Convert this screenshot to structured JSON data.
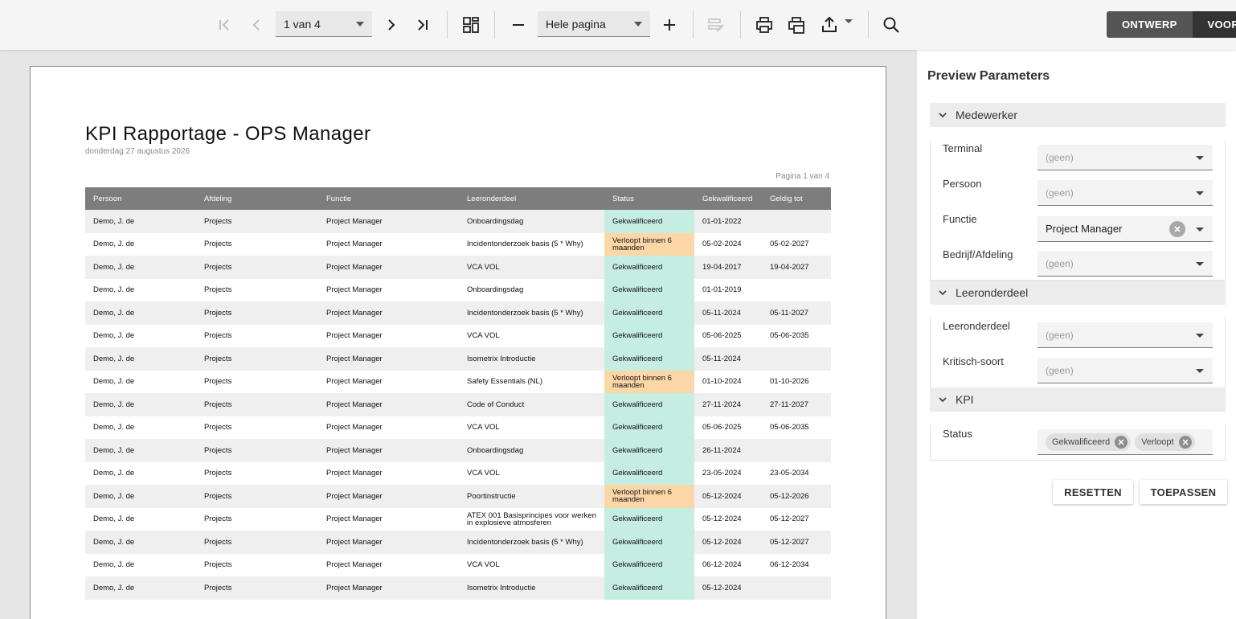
{
  "toolbar": {
    "page_select_value": "1 van 4",
    "zoom_select_value": "Hele pagina",
    "mode_design": "ONTWERP",
    "mode_preview": "VOORBE"
  },
  "report": {
    "title": "KPI Rapportage - OPS Manager",
    "date": "donderdag 27 augustus 2026",
    "page_indicator": "Pagina 1 van 4",
    "columns": [
      "Persoon",
      "Afdeling",
      "Functie",
      "Leeronderdeel",
      "Status",
      "Gekwalificeerd",
      "Geldig tot"
    ],
    "status_colors": {
      "Gekwalificeerd": "#c6ede2",
      "Verloopt binnen 6 maanden": "#fbd7a8"
    },
    "rows": [
      [
        "Demo, J. de",
        "Projects",
        "Project Manager",
        "Onboardingsdag",
        "Gekwalificeerd",
        "01-01-2022",
        ""
      ],
      [
        "Demo, J. de",
        "Projects",
        "Project Manager",
        "Incidentonderzoek basis (5 * Why)",
        "Verloopt binnen 6 maanden",
        "05-02-2024",
        "05-02-2027"
      ],
      [
        "Demo, J. de",
        "Projects",
        "Project Manager",
        "VCA VOL",
        "Gekwalificeerd",
        "19-04-2017",
        "19-04-2027"
      ],
      [
        "Demo, J. de",
        "Projects",
        "Project Manager",
        "Onboardingsdag",
        "Gekwalificeerd",
        "01-01-2019",
        ""
      ],
      [
        "Demo, J. de",
        "Projects",
        "Project Manager",
        "Incidentonderzoek basis (5 * Why)",
        "Gekwalificeerd",
        "05-11-2024",
        "05-11-2027"
      ],
      [
        "Demo, J. de",
        "Projects",
        "Project Manager",
        "VCA VOL",
        "Gekwalificeerd",
        "05-06-2025",
        "05-06-2035"
      ],
      [
        "Demo, J. de",
        "Projects",
        "Project Manager",
        "Isometrix Introductie",
        "Gekwalificeerd",
        "05-11-2024",
        ""
      ],
      [
        "Demo, J. de",
        "Projects",
        "Project Manager",
        "Safety Essentials (NL)",
        "Verloopt binnen 6 maanden",
        "01-10-2024",
        "01-10-2026"
      ],
      [
        "Demo, J. de",
        "Projects",
        "Project Manager",
        "Code of Conduct",
        "Gekwalificeerd",
        "27-11-2024",
        "27-11-2027"
      ],
      [
        "Demo, J. de",
        "Projects",
        "Project Manager",
        "VCA VOL",
        "Gekwalificeerd",
        "05-06-2025",
        "05-06-2035"
      ],
      [
        "Demo, J. de",
        "Projects",
        "Project Manager",
        "Onboardingsdag",
        "Gekwalificeerd",
        "26-11-2024",
        ""
      ],
      [
        "Demo, J. de",
        "Projects",
        "Project Manager",
        "VCA VOL",
        "Gekwalificeerd",
        "23-05-2024",
        "23-05-2034"
      ],
      [
        "Demo, J. de",
        "Projects",
        "Project Manager",
        "Poortinstructie",
        "Verloopt binnen 6 maanden",
        "05-12-2024",
        "05-12-2026"
      ],
      [
        "Demo, J. de",
        "Projects",
        "Project Manager",
        "ATEX 001 Basisprincipes voor werken in explosieve atmosferen",
        "Gekwalificeerd",
        "05-12-2024",
        "05-12-2027"
      ],
      [
        "Demo, J. de",
        "Projects",
        "Project Manager",
        "Incidentonderzoek basis (5 * Why)",
        "Gekwalificeerd",
        "05-12-2024",
        "05-12-2027"
      ],
      [
        "Demo, J. de",
        "Projects",
        "Project Manager",
        "VCA VOL",
        "Gekwalificeerd",
        "06-12-2024",
        "06-12-2034"
      ],
      [
        "Demo, J. de",
        "Projects",
        "Project Manager",
        "Isometrix Introductie",
        "Gekwalificeerd",
        "05-12-2024",
        ""
      ]
    ]
  },
  "panel": {
    "title": "Preview Parameters",
    "groups": {
      "medewerker": "Medewerker",
      "leeronderdeel": "Leeronderdeel",
      "kpi": "KPI"
    },
    "params": {
      "terminal": {
        "label": "Terminal",
        "placeholder": "(geen)"
      },
      "persoon": {
        "label": "Persoon",
        "placeholder": "(geen)"
      },
      "functie": {
        "label": "Functie",
        "value": "Project Manager"
      },
      "bedrijf": {
        "label": "Bedrijf/Afdeling",
        "placeholder": "(geen)"
      },
      "leeronderdeel": {
        "label": "Leeronderdeel",
        "placeholder": "(geen)"
      },
      "kritisch": {
        "label": "Kritisch-soort",
        "placeholder": "(geen)"
      },
      "status": {
        "label": "Status",
        "chips": [
          "Gekwalificeerd",
          "Verloopt"
        ]
      }
    },
    "reset_label": "RESETTEN",
    "apply_label": "TOEPASSEN"
  }
}
